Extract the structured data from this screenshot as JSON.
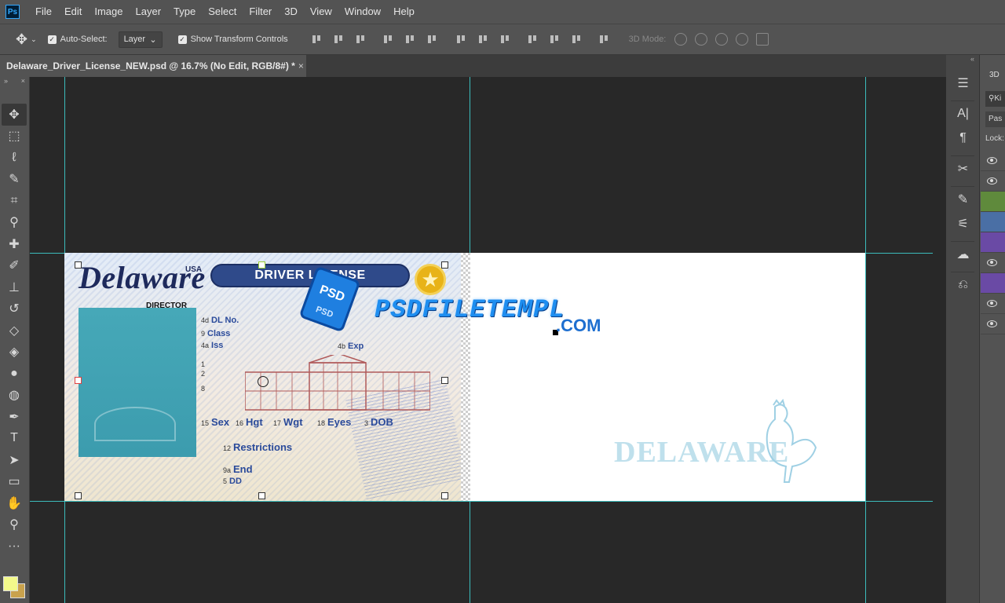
{
  "app": {
    "logo": "Ps"
  },
  "menu": [
    "File",
    "Edit",
    "Image",
    "Layer",
    "Type",
    "Select",
    "Filter",
    "3D",
    "View",
    "Window",
    "Help"
  ],
  "options": {
    "auto_select_label": "Auto-Select:",
    "auto_select_target": "Layer",
    "transform_label": "Show Transform Controls",
    "mode_label": "3D Mode:"
  },
  "document": {
    "tab_title": "Delaware_Driver_License_NEW.psd @ 16.7% (No Edit, RGB/8#) *",
    "close": "×"
  },
  "card": {
    "state": "Delaware",
    "country": "USA",
    "banner": "DRIVER LICENSE",
    "director": "DIRECTOR",
    "fields": {
      "dlno_num": "4d",
      "dlno": "DL No.",
      "class_num": "9",
      "class": "Class",
      "iss_num": "4a",
      "iss": "Iss",
      "exp_num": "4b",
      "exp": "Exp",
      "f1": "1",
      "f2": "2",
      "f8": "8",
      "sex_num": "15",
      "sex": "Sex",
      "hgt_num": "16",
      "hgt": "Hgt",
      "wgt_num": "17",
      "wgt": "Wgt",
      "eyes_num": "18",
      "eyes": "Eyes",
      "dob_num": "3",
      "dob": "DOB",
      "restr_num": "12",
      "restr": "Restrictions",
      "end_num": "9a",
      "end": "End",
      "dd_num": "5",
      "dd": "DD"
    }
  },
  "watermark": {
    "badge_top": "PSD",
    "badge_bottom": "PSD",
    "text": "PSDFILETEMPL",
    "com": ".COM"
  },
  "back": {
    "state": "DELAWARE"
  },
  "right_panel": {
    "tab": "3D",
    "search": "Ki",
    "blend": "Pas",
    "lock": "Lock:"
  },
  "colors": {
    "foreground": "#f3f98b",
    "background": "#c9a24d",
    "guide": "#3fd6d6",
    "layer_green": "#5f8a3c",
    "layer_blue": "#4a6fa5",
    "layer_purple": "#6a4aa5"
  }
}
